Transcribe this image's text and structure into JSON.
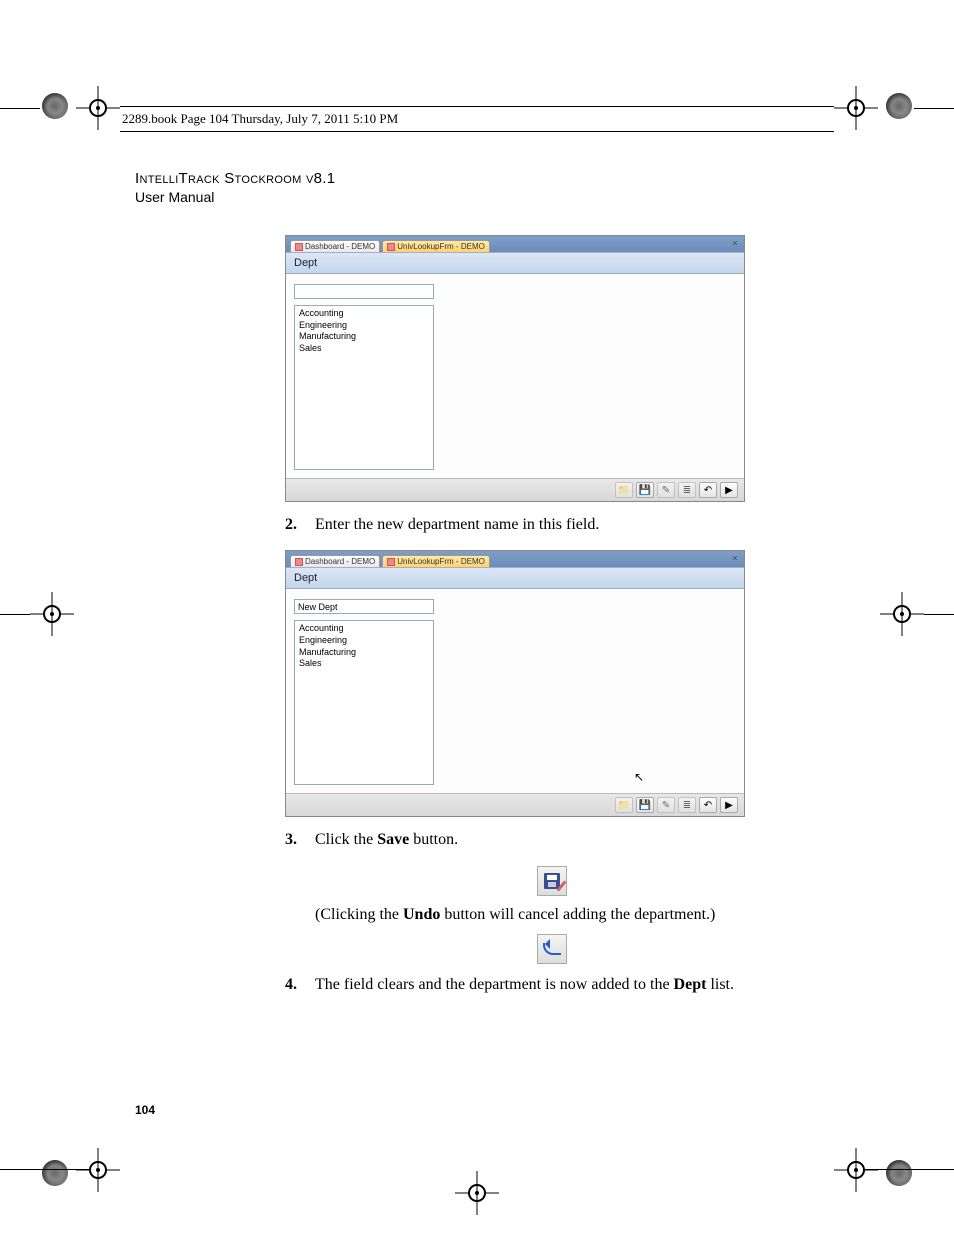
{
  "header_strip": "2289.book  Page 104  Thursday, July 7, 2011  5:10 PM",
  "doc_title": "IntelliTrack Stockroom v8.1",
  "doc_subtitle": "User Manual",
  "page_number": "104",
  "screenshot1": {
    "tabs": {
      "inactive": "Dashboard - DEMO",
      "active": "UnivLookupFrm - DEMO"
    },
    "panel_title": "Dept",
    "input_value": "",
    "list_items": [
      "Accounting",
      "Engineering",
      "Manufacturing",
      "Sales"
    ]
  },
  "screenshot2": {
    "tabs": {
      "inactive": "Dashboard - DEMO",
      "active": "UnivLookupFrm - DEMO"
    },
    "panel_title": "Dept",
    "input_value": "New Dept",
    "list_items": [
      "Accounting",
      "Engineering",
      "Manufacturing",
      "Sales"
    ]
  },
  "steps": {
    "s2": {
      "num": "2.",
      "text_before": "Enter the new department name in this field."
    },
    "s3": {
      "num": "3.",
      "prefix": "Click the ",
      "bold": "Save",
      "suffix": " button."
    },
    "s3_note": {
      "prefix": "(Clicking the ",
      "bold": "Undo",
      "suffix": " button will cancel adding the department.)"
    },
    "s4": {
      "num": "4.",
      "prefix": "The field clears and the department is now added to the ",
      "bold": "Dept",
      "suffix": " list."
    }
  },
  "toolbar_icons": [
    "folder-icon",
    "save-icon",
    "edit-icon",
    "list-icon",
    "undo-icon",
    "next-icon"
  ]
}
